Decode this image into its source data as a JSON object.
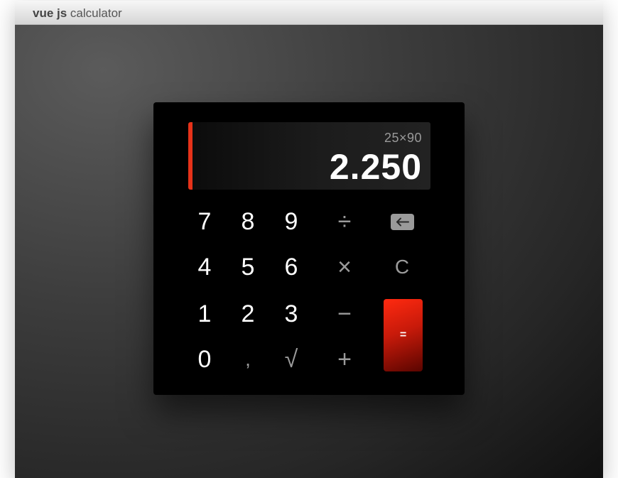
{
  "window": {
    "title_bold": "vue js",
    "title_rest": " calculator"
  },
  "display": {
    "expression": "25×90",
    "result": "2.250",
    "accent_color": "#e63219"
  },
  "keys": {
    "seven": "7",
    "eight": "8",
    "nine": "9",
    "divide": "÷",
    "backspace_icon": "backspace-arrow-icon",
    "four": "4",
    "five": "5",
    "six": "6",
    "multiply": "×",
    "clear": "C",
    "one": "1",
    "two": "2",
    "three": "3",
    "minus": "−",
    "zero": "0",
    "comma": ",",
    "sqrt": "√",
    "plus": "+",
    "equals": "="
  },
  "colors": {
    "equals_start": "#ff2a10",
    "equals_end": "#5a0500",
    "operator_gray": "#9b9b9b"
  }
}
